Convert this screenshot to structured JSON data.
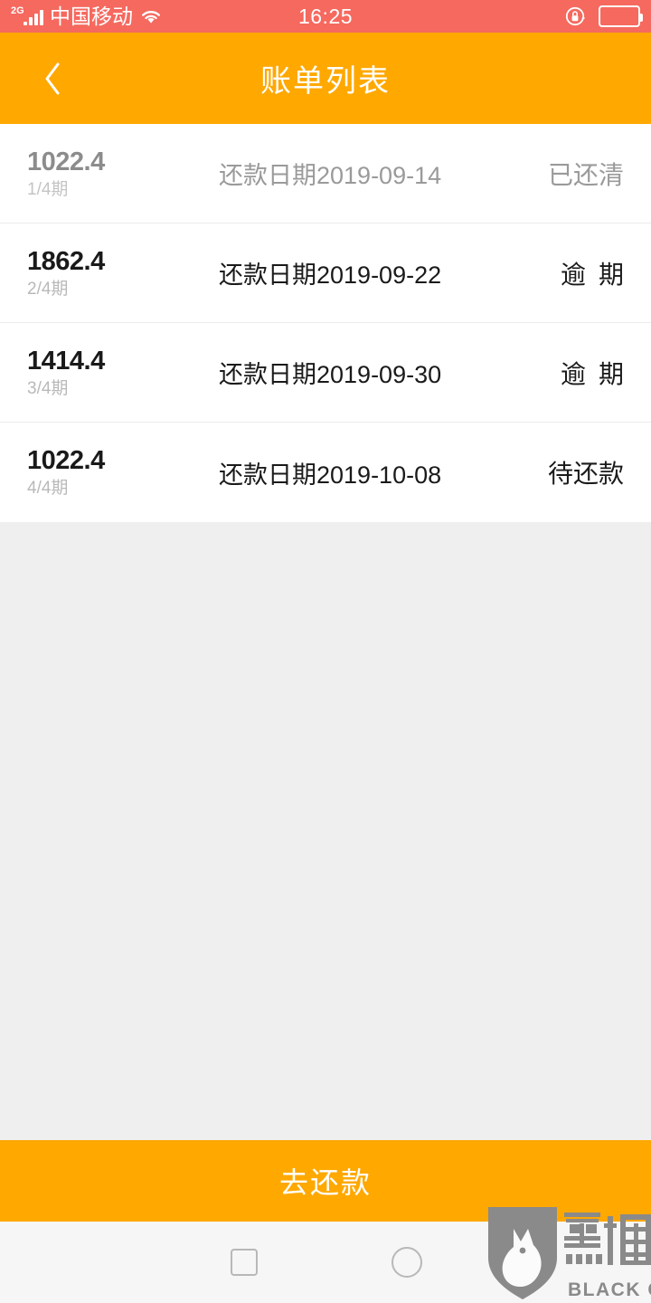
{
  "status_bar": {
    "network_type": "2G",
    "carrier": "中国移动",
    "time": "16:25",
    "wifi_icon": "wifi-icon",
    "rotation_lock_icon": "rotation-lock-icon",
    "battery_icon": "battery-icon"
  },
  "header": {
    "back_icon": "chevron-left-icon",
    "title": "账单列表"
  },
  "bills": [
    {
      "amount": "1022.4",
      "period": "1/4期",
      "date": "还款日期2019-09-14",
      "status": "已还清",
      "paid": true,
      "spaced_status": false
    },
    {
      "amount": "1862.4",
      "period": "2/4期",
      "date": "还款日期2019-09-22",
      "status": "逾期",
      "paid": false,
      "spaced_status": true
    },
    {
      "amount": "1414.4",
      "period": "3/4期",
      "date": "还款日期2019-09-30",
      "status": "逾期",
      "paid": false,
      "spaced_status": true
    },
    {
      "amount": "1022.4",
      "period": "4/4期",
      "date": "还款日期2019-10-08",
      "status": "待还款",
      "paid": false,
      "spaced_status": false
    }
  ],
  "cta": {
    "label": "去还款"
  },
  "nav_bar": {
    "recents_icon": "square-recents-icon",
    "home_icon": "circle-home-icon"
  },
  "watermark": {
    "shield_icon": "black-cat-shield-icon",
    "cn_text": "黑猫",
    "en_text": "BLACK CAT"
  },
  "colors": {
    "status_bar": "#f5695f",
    "header": "#ffa800",
    "accent": "#ffa800",
    "page_background": "#efefef",
    "list_background": "#ffffff",
    "text_primary": "#1a1a1a",
    "text_muted": "#9a9a9a"
  }
}
